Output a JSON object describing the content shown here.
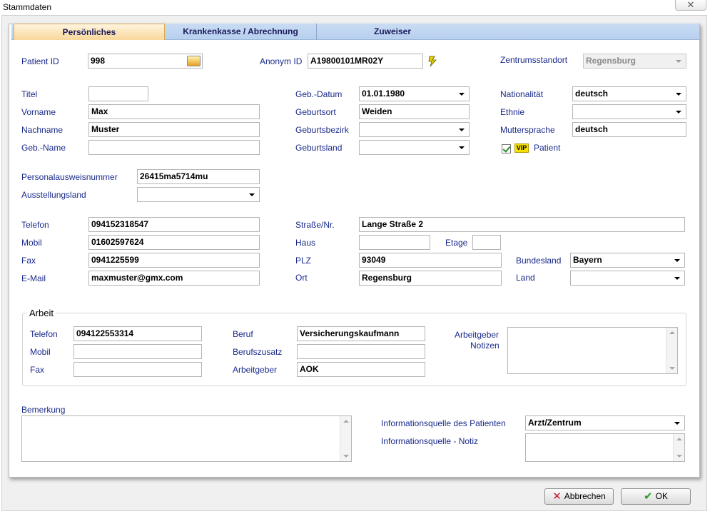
{
  "window": {
    "title": "Stammdaten"
  },
  "tabs": [
    {
      "label": "Persönliches"
    },
    {
      "label": "Krankenkasse / Abrechnung"
    },
    {
      "label": "Zuweiser"
    }
  ],
  "header": {
    "patient_id_label": "Patient ID",
    "patient_id_value": "998",
    "anonym_id_label": "Anonym ID",
    "anonym_id_value": "A19800101MR02Y",
    "zentrum_label": "Zentrumsstandort",
    "zentrum_value": "Regensburg"
  },
  "personal": {
    "titel_label": "Titel",
    "titel_value": "",
    "vorname_label": "Vorname",
    "vorname_value": "Max",
    "nachname_label": "Nachname",
    "nachname_value": "Muster",
    "gebname_label": "Geb.-Name",
    "gebname_value": "",
    "gebdatum_label": "Geb.-Datum",
    "gebdatum_value": "01.01.1980",
    "geburtsort_label": "Geburtsort",
    "geburtsort_value": "Weiden",
    "geburtsbezirk_label": "Geburtsbezirk",
    "geburtsbezirk_value": "",
    "geburtsland_label": "Geburtsland",
    "geburtsland_value": "",
    "nationalitaet_label": "Nationalität",
    "nationalitaet_value": "deutsch",
    "ethnie_label": "Ethnie",
    "ethnie_value": "",
    "muttersprache_label": "Muttersprache",
    "muttersprache_value": "deutsch",
    "vip_badge": "VIP",
    "vip_label": "Patient",
    "ausweis_label": "Personalausweisnummer",
    "ausweis_value": "26415ma5714mu",
    "ausstellungsland_label": "Ausstellungsland",
    "ausstellungsland_value": ""
  },
  "contact": {
    "telefon_label": "Telefon",
    "telefon_value": "094152318547",
    "mobil_label": "Mobil",
    "mobil_value": "01602597624",
    "fax_label": "Fax",
    "fax_value": "0941225599",
    "email_label": "E-Mail",
    "email_value": "maxmuster@gmx.com",
    "strasse_label": "Straße/Nr.",
    "strasse_value": "Lange Straße 2",
    "haus_label": "Haus",
    "haus_value": "",
    "etage_label": "Etage",
    "etage_value": "",
    "plz_label": "PLZ",
    "plz_value": "93049",
    "ort_label": "Ort",
    "ort_value": "Regensburg",
    "bundesland_label": "Bundesland",
    "bundesland_value": "Bayern",
    "land_label": "Land",
    "land_value": ""
  },
  "arbeit": {
    "group_title": "Arbeit",
    "telefon_label": "Telefon",
    "telefon_value": "094122553314",
    "mobil_label": "Mobil",
    "mobil_value": "",
    "fax_label": "Fax",
    "fax_value": "",
    "beruf_label": "Beruf",
    "beruf_value": "Versicherungskaufmann",
    "berufszusatz_label": "Berufszusatz",
    "berufszusatz_value": "",
    "arbeitgeber_label": "Arbeitgeber",
    "arbeitgeber_value": "AOK",
    "notizen_label_1": "Arbeitgeber",
    "notizen_label_2": "Notizen"
  },
  "footer": {
    "bemerkung_label": "Bemerkung",
    "infoquelle_label": "Informationsquelle des Patienten",
    "infoquelle_value": "Arzt/Zentrum",
    "infoquelle_notiz_label": "Informationsquelle - Notiz"
  },
  "buttons": {
    "cancel_label": "Abbrechen",
    "ok_label": "OK"
  },
  "colors": {
    "label_blue": "#1a2a8a",
    "tab_active": "#f8d79a",
    "tab_inactive": "#c9dcf3"
  }
}
